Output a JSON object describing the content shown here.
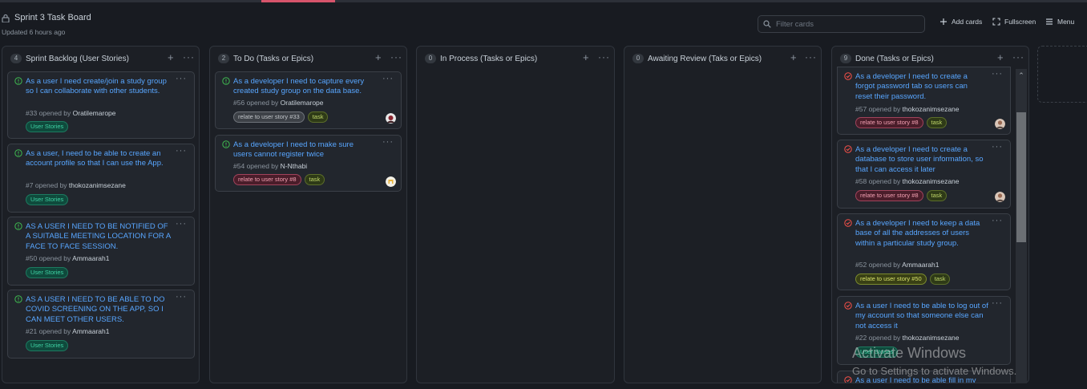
{
  "board": {
    "title": "Sprint 3 Task Board",
    "updated": "Updated 6 hours ago",
    "filter_placeholder": "Filter cards",
    "add_cards": "Add cards",
    "fullscreen": "Fullscreen",
    "menu": "Menu"
  },
  "columns": [
    {
      "count": "4",
      "title": "Sprint Backlog (User Stories)",
      "cards": [
        {
          "title": "As a user I need create/join a study group so I can collaborate with other students.",
          "number": "#33",
          "opened_by": "opened by",
          "user": "Oratilemarope",
          "labels": [
            "User Stories"
          ]
        },
        {
          "title": "As a user, I need to be able to create an account profile so that I can use the App.",
          "number": "#7",
          "opened_by": "opened by",
          "user": "thokozanimsezane",
          "labels": [
            "User Stories"
          ]
        },
        {
          "title": "AS A USER I NEED TO BE NOTIFIED OF A SUITABLE MEETING LOCATION FOR A FACE TO FACE SESSION.",
          "number": "#50",
          "opened_by": "opened by",
          "user": "Ammaarah1",
          "labels": [
            "User Stories"
          ]
        },
        {
          "title": "AS A USER I NEED TO BE ABLE TO DO COVID SCREENING ON THE APP, SO I CAN MEET OTHER USERS.",
          "number": "#21",
          "opened_by": "opened by",
          "user": "Ammaarah1",
          "labels": [
            "User Stories"
          ]
        }
      ]
    },
    {
      "count": "2",
      "title": "To Do (Tasks or Epics)",
      "cards": [
        {
          "title": "As a developer I need to capture every created study group on the data base.",
          "number": "#56",
          "opened_by": "opened by",
          "user": "Oratilemarope",
          "labels": [
            "relate to user story #33",
            "task"
          ]
        },
        {
          "title": "As a developer I need to make sure users cannot register twice",
          "number": "#54",
          "opened_by": "opened by",
          "user": "N-Nthabi",
          "labels": [
            "relate to user story #8",
            "task"
          ]
        }
      ]
    },
    {
      "count": "0",
      "title": "In Process (Tasks or Epics)",
      "cards": []
    },
    {
      "count": "0",
      "title": "Awaiting Review (Taks or Epics)",
      "cards": []
    },
    {
      "count": "9",
      "title": "Done (Tasks or Epics)",
      "cards": [
        {
          "title": "As a developer I need to create a forgot password tab so users can reset their password.",
          "number": "#57",
          "opened_by": "opened by",
          "user": "thokozanimsezane",
          "labels": [
            "relate to user story #8",
            "task"
          ]
        },
        {
          "title": "As a developer I need to create a database to store user information, so that I can access it later",
          "number": "#58",
          "opened_by": "opened by",
          "user": "thokozanimsezane",
          "labels": [
            "relate to user story #8",
            "task"
          ]
        },
        {
          "title": "As a developer I need to keep a data base of all the addresses of users within a particular study group.",
          "number": "#52",
          "opened_by": "opened by",
          "user": "Ammaarah1",
          "labels": [
            "relate to user story #50",
            "task"
          ]
        },
        {
          "title": "As a user I need to be able to log out of my account so that someone else can not access it",
          "number": "#22",
          "opened_by": "opened by",
          "user": "thokozanimsezane",
          "labels": [
            "User Stories"
          ]
        },
        {
          "title": "As a user I need to be able fill in my",
          "number": "",
          "opened_by": "",
          "user": "",
          "labels": []
        }
      ]
    }
  ],
  "watermark": {
    "line1": "Activate Windows",
    "line2": "Go to Settings to activate Windows."
  },
  "colors": {
    "background": "#181b21",
    "column": "#1c1f25",
    "card": "#22262d",
    "link": "#58a6ff",
    "open_status": "#3fb950",
    "closed_status": "#f85149"
  }
}
